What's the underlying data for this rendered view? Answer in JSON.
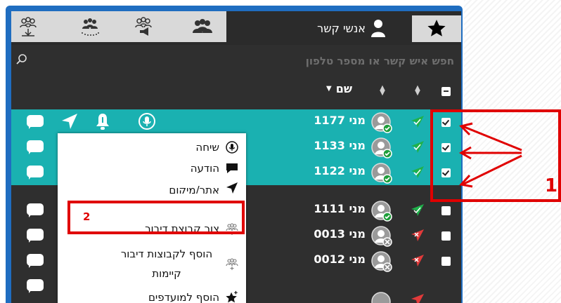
{
  "tabs": {
    "contacts_label": "אנשי קשר",
    "group_icons": [
      "talkgroup-download-icon",
      "talkgroup-dotted-icon",
      "talkgroup-broadcast-icon",
      "talkgroup-people-icon"
    ]
  },
  "search": {
    "placeholder": "חפש איש קשר או מספר טלפון"
  },
  "table": {
    "name_header": "שם"
  },
  "rows": [
    {
      "name": "מני 1177",
      "selected": true,
      "checked": true,
      "status": "online",
      "arrow": "green"
    },
    {
      "name": "מני 1133",
      "selected": true,
      "checked": true,
      "status": "online",
      "arrow": "green"
    },
    {
      "name": "מני 1122",
      "selected": true,
      "checked": true,
      "status": "online",
      "arrow": "green"
    },
    {
      "name": "מני 1111",
      "selected": false,
      "checked": false,
      "status": "online",
      "arrow": "green"
    },
    {
      "name": "מני 0013",
      "selected": false,
      "checked": false,
      "status": "offline",
      "arrow": "red"
    },
    {
      "name": "מני 0012",
      "selected": false,
      "checked": false,
      "status": "offline",
      "arrow": "red"
    }
  ],
  "context_menu": {
    "items": [
      {
        "label": "שיחה",
        "icon": "microphone-icon"
      },
      {
        "label": "הודעה",
        "icon": "chat-bubble-icon"
      },
      {
        "label": "אתר/מיקום",
        "icon": "location-arrow-icon"
      },
      {
        "label": "צור קבוצת דיבור",
        "icon": "talkgroup-add-icon"
      },
      {
        "label": "הוסף לקבוצות דיבור קיימות",
        "icon": "talkgroup-existing-icon"
      },
      {
        "label": "הוסף למועדפים",
        "icon": "star-plus-icon"
      }
    ]
  },
  "annotations": {
    "step1": "1",
    "step2": "2"
  },
  "colors": {
    "selected_row": "#1ab1b1",
    "frame_blue": "#1f6dc0",
    "annotation_red": "#e00000"
  }
}
